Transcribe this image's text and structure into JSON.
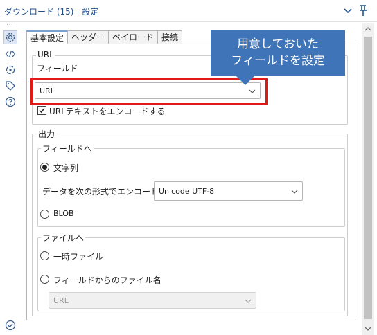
{
  "window": {
    "title": "ダウンロード (15) - 設定"
  },
  "tabs": [
    {
      "label": "基本設定"
    },
    {
      "label": "ヘッダー"
    },
    {
      "label": "ペイロード"
    },
    {
      "label": "接続"
    }
  ],
  "url_group": {
    "label": "URL",
    "field_label": "フィールド",
    "field_value": "URL",
    "encode_label": "URLテキストをエンコードする",
    "encode_checked": true
  },
  "output_group": {
    "label": "出力",
    "to_field": {
      "label": "フィールドへ",
      "string_label": "文字列",
      "string_selected": true,
      "encode_label": "データを次の形式でエンコード:",
      "encoding_value": "Unicode UTF-8",
      "blob_label": "BLOB",
      "blob_selected": false
    },
    "to_file": {
      "label": "ファイルへ",
      "temp_label": "一時ファイル",
      "temp_selected": false,
      "fromfield_label": "フィールドからのファイル名",
      "fromfield_selected": false,
      "filename_field_value": "URL"
    }
  },
  "callout": {
    "line1": "用意しておいた",
    "line2": "フィールドを設定"
  },
  "colors": {
    "accent": "#3f74b8",
    "highlight": "#e11919",
    "title": "#1f4e8c"
  }
}
